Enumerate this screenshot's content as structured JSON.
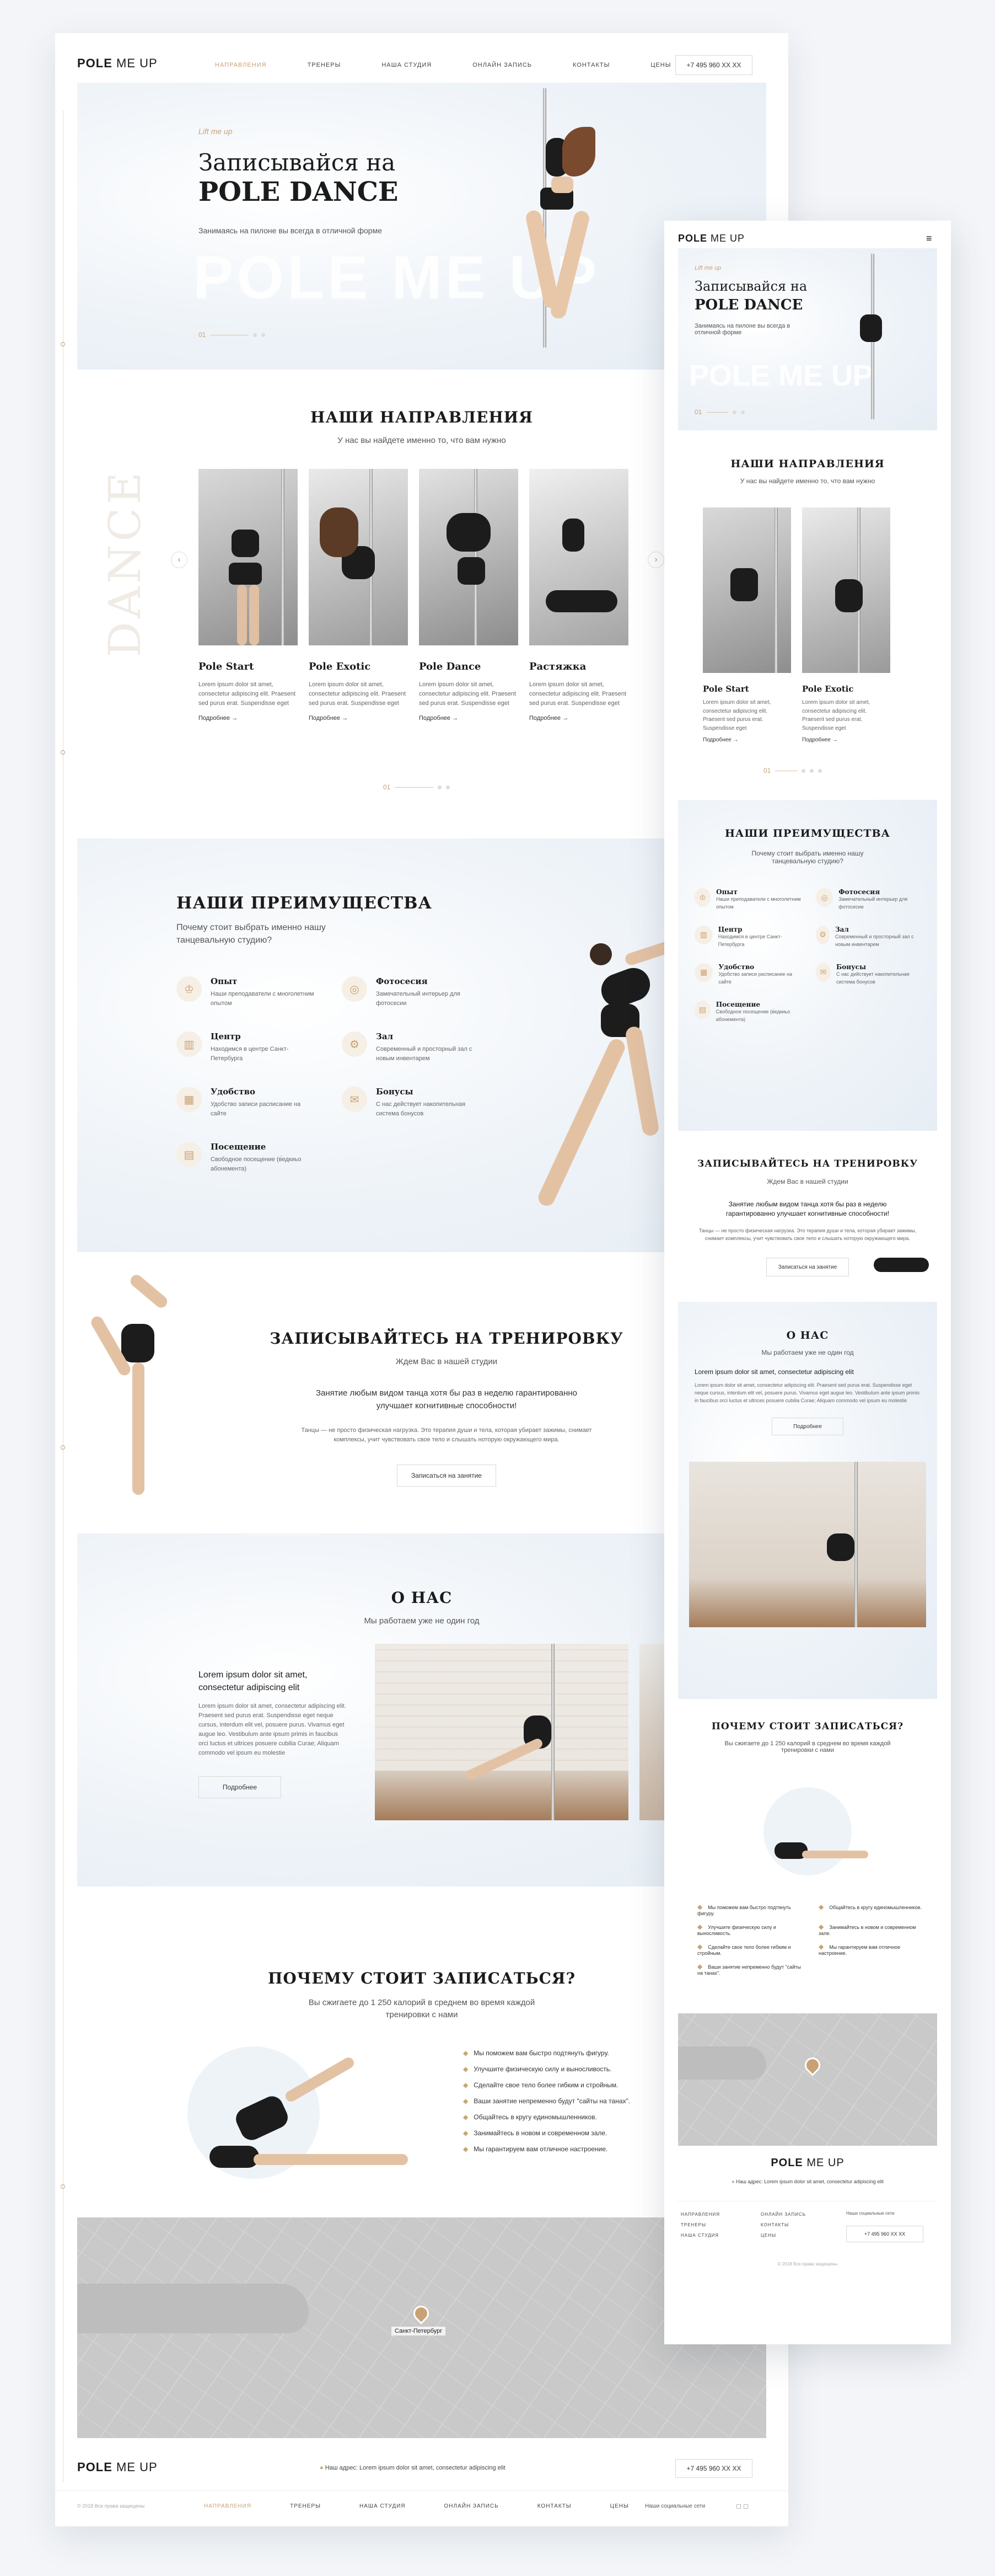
{
  "header": {
    "logo_bold": "POLE",
    "logo_light": "ME UP",
    "nav": [
      "НАПРАВЛЕНИЯ",
      "ТРЕНЕРЫ",
      "НАША СТУДИЯ",
      "ОНЛАЙН ЗАПИСЬ",
      "КОНТАКТЫ",
      "ЦЕНЫ"
    ],
    "phone": "+7 495 960 XX XX"
  },
  "hero": {
    "kicker": "Lift me up",
    "title_line1": "Записывайся на",
    "title_line2": "POLE DANCE",
    "subtitle": "Занимаясь на пилоне вы всегда в отличной форме",
    "bg_text": "POLE ME UP",
    "page_num": "01"
  },
  "directions": {
    "title": "НАШИ НАПРАВЛЕНИЯ",
    "subtitle": "У нас вы найдете именно то, что вам нужно",
    "bg_word": "DANCE",
    "cards": [
      {
        "title": "Pole Start",
        "text": "Lorem ipsum dolor sit amet, consectetur adipiscing elit. Praesent sed purus erat. Suspendisse eget",
        "more": "Подробнее →"
      },
      {
        "title": "Pole Exotic",
        "text": "Lorem ipsum dolor sit amet, consectetur adipiscing elit. Praesent sed purus erat. Suspendisse eget",
        "more": "Подробнее →"
      },
      {
        "title": "Pole Dance",
        "text": "Lorem ipsum dolor sit amet, consectetur adipiscing elit. Praesent sed purus erat. Suspendisse eget",
        "more": "Подробнее →"
      },
      {
        "title": "Растяжка",
        "text": "Lorem ipsum dolor sit amet, consectetur adipiscing elit. Praesent sed purus erat. Suspendisse eget",
        "more": "Подробнее →"
      }
    ],
    "page_num": "01"
  },
  "advantages": {
    "title": "НАШИ ПРЕИМУЩЕСТВА",
    "subtitle": "Почему стоит выбрать именно нашу танцевальную студию?",
    "items": [
      {
        "title": "Опыт",
        "text": "Наши преподаватели с многолетним опытом",
        "icon": "trophy-icon"
      },
      {
        "title": "Фотосесия",
        "text": "Замечательный интерьер для фотосесии",
        "icon": "camera-icon"
      },
      {
        "title": "Центр",
        "text": "Находимся в центре Санкт-Петербурга",
        "icon": "building-icon"
      },
      {
        "title": "Зал",
        "text": "Современный и просторный зал с новым инвентарем",
        "icon": "gym-icon"
      },
      {
        "title": "Удобство",
        "text": "Удобство записи расписание на сайте",
        "icon": "calendar-icon"
      },
      {
        "title": "Бонусы",
        "text": "С нас действует накопительная система бонусов",
        "icon": "gift-icon"
      },
      {
        "title": "Посещение",
        "text": "Свободное посещение (в́едкиьо абонемента)",
        "icon": "ticket-icon"
      }
    ]
  },
  "signup": {
    "title": "ЗАПИСЫВАЙТЕСЬ НА ТРЕНИРОВКУ",
    "subtitle": "Ждем Вас в нашей студии",
    "lead": "Занятие любым видом танца хотя бы раз в неделю гарантированно улучшает когнитивные способности!",
    "text": "Танцы — не просто физическая нагрузка. Это терапия души и тела, которая убирает зажимы, снимает комплексы, учит чувствовать свое тело и слышать ноторую окружающего мира.",
    "button": "Записаться на занятие"
  },
  "about": {
    "title": "О НАС",
    "subtitle": "Мы работаем уже не один год",
    "lead": "Lorem ipsum dolor sit amet, consectetur adipiscing elit",
    "text": "Lorem ipsum dolor sit amet, consectetur adipiscing elit. Praesent sed purus erat. Suspendisse eget neque cursus, interdum elit vel, posuere purus. Vivamus eget augue leo. Vestibulum ante ipsum primis in faucibus orci luctus et ultrices posuere cubilia Curae; Aliquam commodo vel ipsum eu molestie",
    "button": "Подробнее"
  },
  "why": {
    "title": "ПОЧЕМУ СТОИТ ЗАПИСАТЬСЯ?",
    "subtitle": "Вы сжигаете до 1 250 калорий в среднем во время каждой тренировки с нами",
    "items": [
      "Мы поможем вам быстро подтянуть фигуру.",
      "Улучшите физическую силу и выносливость.",
      "Сделайте свое тело более гибким и стройным.",
      "Ваши занятие непременно будут \"сайты на танах\".",
      "Общайтесь в кругу единомышленников.",
      "Занимайтесь в новом и современном зале.",
      "Мы гарантируем вам отличное настроение."
    ]
  },
  "footer": {
    "address": "Наш адрес: Lorem ipsum dolor sit amet, consectetur adipiscing elit",
    "phone": "+7 495 960 XX XX",
    "copyright": "© 2018 Все права защищены",
    "social": "Наши социальные сети",
    "map_label": "Санкт-Петербург"
  },
  "mobile": {
    "directions_cards": [
      "Pole Start",
      "Pole Exotic"
    ],
    "advantages_subtitle": "Почему стоит выбрать именно нашу танцевальную студию?",
    "footer_nav": [
      "НАПРАВЛЕНИЯ",
      "ОНЛАЙН ЗАПИСЬ",
      "ТРЕНЕРЫ",
      "КОНТАКТЫ",
      "НАША СТУДИЯ",
      "ЦЕНЫ"
    ]
  }
}
